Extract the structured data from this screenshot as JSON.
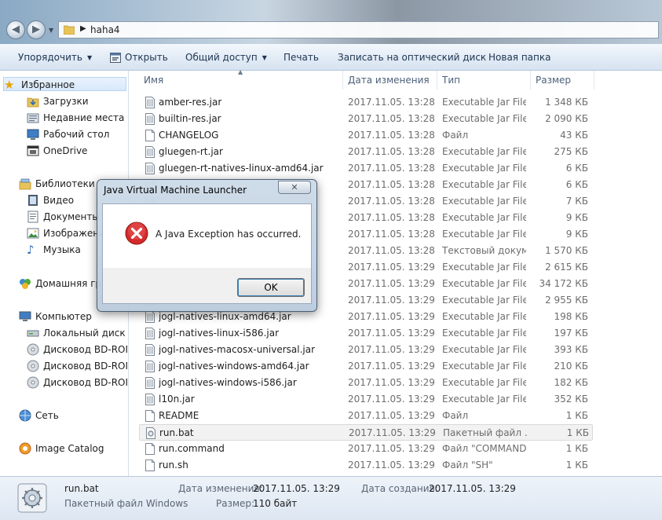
{
  "address": {
    "crumb": "haha4"
  },
  "toolbar": {
    "organize": "Упорядочить",
    "open": "Открыть",
    "share": "Общий доступ",
    "print": "Печать",
    "burn": "Записать на оптический диск",
    "new_folder": "Новая папка"
  },
  "nav": {
    "favorites": "Избранное",
    "downloads": "Загрузки",
    "recent": "Недавние места",
    "desktop": "Рабочий стол",
    "onedrive": "OneDrive",
    "libraries": "Библиотеки",
    "video": "Видео",
    "documents": "Документы",
    "images": "Изображения",
    "music": "Музыка",
    "homegroup": "Домашняя группа",
    "computer": "Компьютер",
    "local_disk": "Локальный диск (C:)",
    "bd1": "Дисковод BD-ROM",
    "bd2": "Дисковод BD-ROM",
    "bd3": "Дисковод BD-ROM",
    "network": "Сеть",
    "image_catalog": "Image Catalog"
  },
  "columns": {
    "name": "Имя",
    "date": "Дата изменения",
    "type": "Тип",
    "size": "Размер"
  },
  "files": [
    {
      "name": "amber-res.jar",
      "date": "2017.11.05. 13:28",
      "type": "Executable Jar File",
      "size": "1 348 КБ"
    },
    {
      "name": "builtin-res.jar",
      "date": "2017.11.05. 13:28",
      "type": "Executable Jar File",
      "size": "2 090 КБ"
    },
    {
      "name": "CHANGELOG",
      "date": "2017.11.05. 13:28",
      "type": "Файл",
      "size": "43 КБ"
    },
    {
      "name": "gluegen-rt.jar",
      "date": "2017.11.05. 13:28",
      "type": "Executable Jar File",
      "size": "275 КБ"
    },
    {
      "name": "gluegen-rt-natives-linux-amd64.jar",
      "date": "2017.11.05. 13:28",
      "type": "Executable Jar File",
      "size": "6 КБ"
    },
    {
      "name": "",
      "date": "2017.11.05. 13:28",
      "type": "Executable Jar File",
      "size": "6 КБ"
    },
    {
      "name": "",
      "date": "2017.11.05. 13:28",
      "type": "Executable Jar File",
      "size": "7 КБ"
    },
    {
      "name": "",
      "date": "2017.11.05. 13:28",
      "type": "Executable Jar File",
      "size": "9 КБ"
    },
    {
      "name": "",
      "date": "2017.11.05. 13:28",
      "type": "Executable Jar File",
      "size": "9 КБ"
    },
    {
      "name": "",
      "date": "2017.11.05. 13:28",
      "type": "Текстовый докум...",
      "size": "1 570 КБ"
    },
    {
      "name": "",
      "date": "2017.11.05. 13:29",
      "type": "Executable Jar File",
      "size": "2 615 КБ"
    },
    {
      "name": "",
      "date": "2017.11.05. 13:29",
      "type": "Executable Jar File",
      "size": "34 172 КБ"
    },
    {
      "name": "",
      "date": "2017.11.05. 13:29",
      "type": "Executable Jar File",
      "size": "2 955 КБ"
    },
    {
      "name": "jogl-natives-linux-amd64.jar",
      "date": "2017.11.05. 13:29",
      "type": "Executable Jar File",
      "size": "198 КБ"
    },
    {
      "name": "jogl-natives-linux-i586.jar",
      "date": "2017.11.05. 13:29",
      "type": "Executable Jar File",
      "size": "197 КБ"
    },
    {
      "name": "jogl-natives-macosx-universal.jar",
      "date": "2017.11.05. 13:29",
      "type": "Executable Jar File",
      "size": "393 КБ"
    },
    {
      "name": "jogl-natives-windows-amd64.jar",
      "date": "2017.11.05. 13:29",
      "type": "Executable Jar File",
      "size": "210 КБ"
    },
    {
      "name": "jogl-natives-windows-i586.jar",
      "date": "2017.11.05. 13:29",
      "type": "Executable Jar File",
      "size": "182 КБ"
    },
    {
      "name": "l10n.jar",
      "date": "2017.11.05. 13:29",
      "type": "Executable Jar File",
      "size": "352 КБ"
    },
    {
      "name": "README",
      "date": "2017.11.05. 13:29",
      "type": "Файл",
      "size": "1 КБ"
    },
    {
      "name": "run.bat",
      "date": "2017.11.05. 13:29",
      "type": "Пакетный файл ...",
      "size": "1 КБ"
    },
    {
      "name": "run.command",
      "date": "2017.11.05. 13:29",
      "type": "Файл \"COMMAND\"",
      "size": "1 КБ"
    },
    {
      "name": "run.sh",
      "date": "2017.11.05. 13:29",
      "type": "Файл \"SH\"",
      "size": "1 КБ"
    }
  ],
  "details": {
    "name": "run.bat",
    "type": "Пакетный файл Windows",
    "modified_label": "Дата изменения:",
    "modified_value": "2017.11.05. 13:29",
    "created_label": "Дата создания:",
    "created_value": "2017.11.05. 13:29",
    "size_label": "Размер:",
    "size_value": "110 байт"
  },
  "dialog": {
    "title": "Java Virtual Machine Launcher",
    "message": "A Java Exception has occurred.",
    "ok": "OK",
    "close_glyph": "✕"
  },
  "icons": {
    "jar": "jar-file-icon",
    "plain": "blank-file-icon",
    "bat": "batch-file-icon",
    "error": "error-icon",
    "folder": "folder-icon"
  }
}
